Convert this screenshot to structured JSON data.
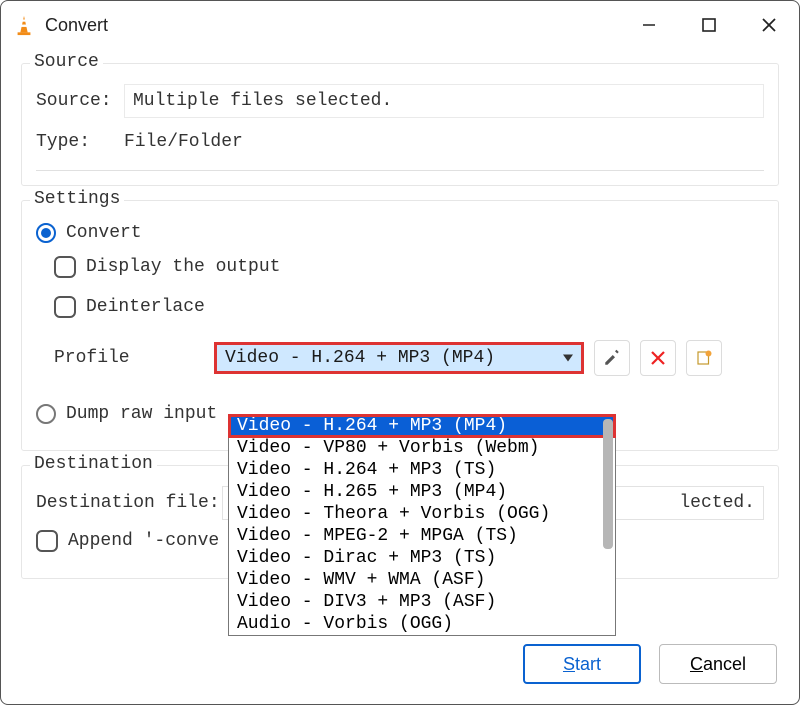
{
  "window": {
    "title": "Convert"
  },
  "source": {
    "legend": "Source",
    "source_label": "Source:",
    "source_value": "Multiple files selected.",
    "type_label": "Type:",
    "type_value": "File/Folder"
  },
  "settings": {
    "legend": "Settings",
    "convert_label": "Convert",
    "display_output_label": "Display the output",
    "deinterlace_label": "Deinterlace",
    "profile_label": "Profile",
    "profile_selected": "Video - H.264 + MP3 (MP4)",
    "dump_raw_label": "Dump raw input",
    "profile_options": [
      "Video - H.264 + MP3 (MP4)",
      "Video - VP80 + Vorbis (Webm)",
      "Video - H.264 + MP3 (TS)",
      "Video - H.265 + MP3 (MP4)",
      "Video - Theora + Vorbis (OGG)",
      "Video - MPEG-2 + MPGA (TS)",
      "Video - Dirac + MP3 (TS)",
      "Video - WMV + WMA (ASF)",
      "Video - DIV3 + MP3 (ASF)",
      "Audio - Vorbis (OGG)"
    ]
  },
  "destination": {
    "legend": "Destination",
    "file_label": "Destination file:",
    "file_value_visible": "lected.",
    "append_label": "Append '-conve"
  },
  "buttons": {
    "start": "Start",
    "cancel": "Cancel"
  },
  "icons": {
    "wrench": "wrench-icon",
    "delete": "delete-icon",
    "new": "new-profile-icon"
  }
}
